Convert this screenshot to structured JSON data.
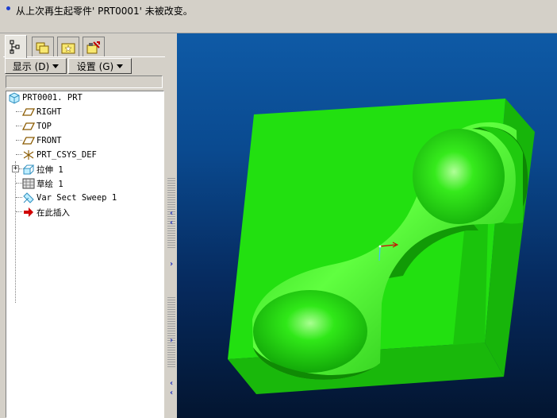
{
  "message_bar": {
    "text": "从上次再生起零件' PRT0001' 未被改变。"
  },
  "navigator": {
    "tabs": [
      {
        "icon": "model-tree-icon",
        "active": true
      },
      {
        "icon": "folder-browser-icon",
        "active": false
      },
      {
        "icon": "favorites-icon",
        "active": false
      },
      {
        "icon": "connections-icon",
        "active": false
      }
    ],
    "show_menu_label": "显示 (D)",
    "settings_menu_label": "设置 (G)",
    "tree": {
      "root": "PRT0001. PRT",
      "items": [
        {
          "label": "RIGHT",
          "icon": "datum-plane-icon"
        },
        {
          "label": "TOP",
          "icon": "datum-plane-icon"
        },
        {
          "label": "FRONT",
          "icon": "datum-plane-icon"
        },
        {
          "label": "PRT_CSYS_DEF",
          "icon": "coordinate-system-icon"
        },
        {
          "label": "拉伸 1",
          "icon": "extrude-icon"
        },
        {
          "label": "草绘 1",
          "icon": "sketch-icon"
        },
        {
          "label": "Var Sect Sweep 1",
          "icon": "sweep-icon"
        },
        {
          "label": "在此插入",
          "icon": "insert-here-icon"
        }
      ]
    }
  },
  "colors": {
    "model_green": "#22e010",
    "viewport_top": "#0e5aa6",
    "viewport_bottom": "#031530",
    "insert_arrow": "#d00000"
  }
}
